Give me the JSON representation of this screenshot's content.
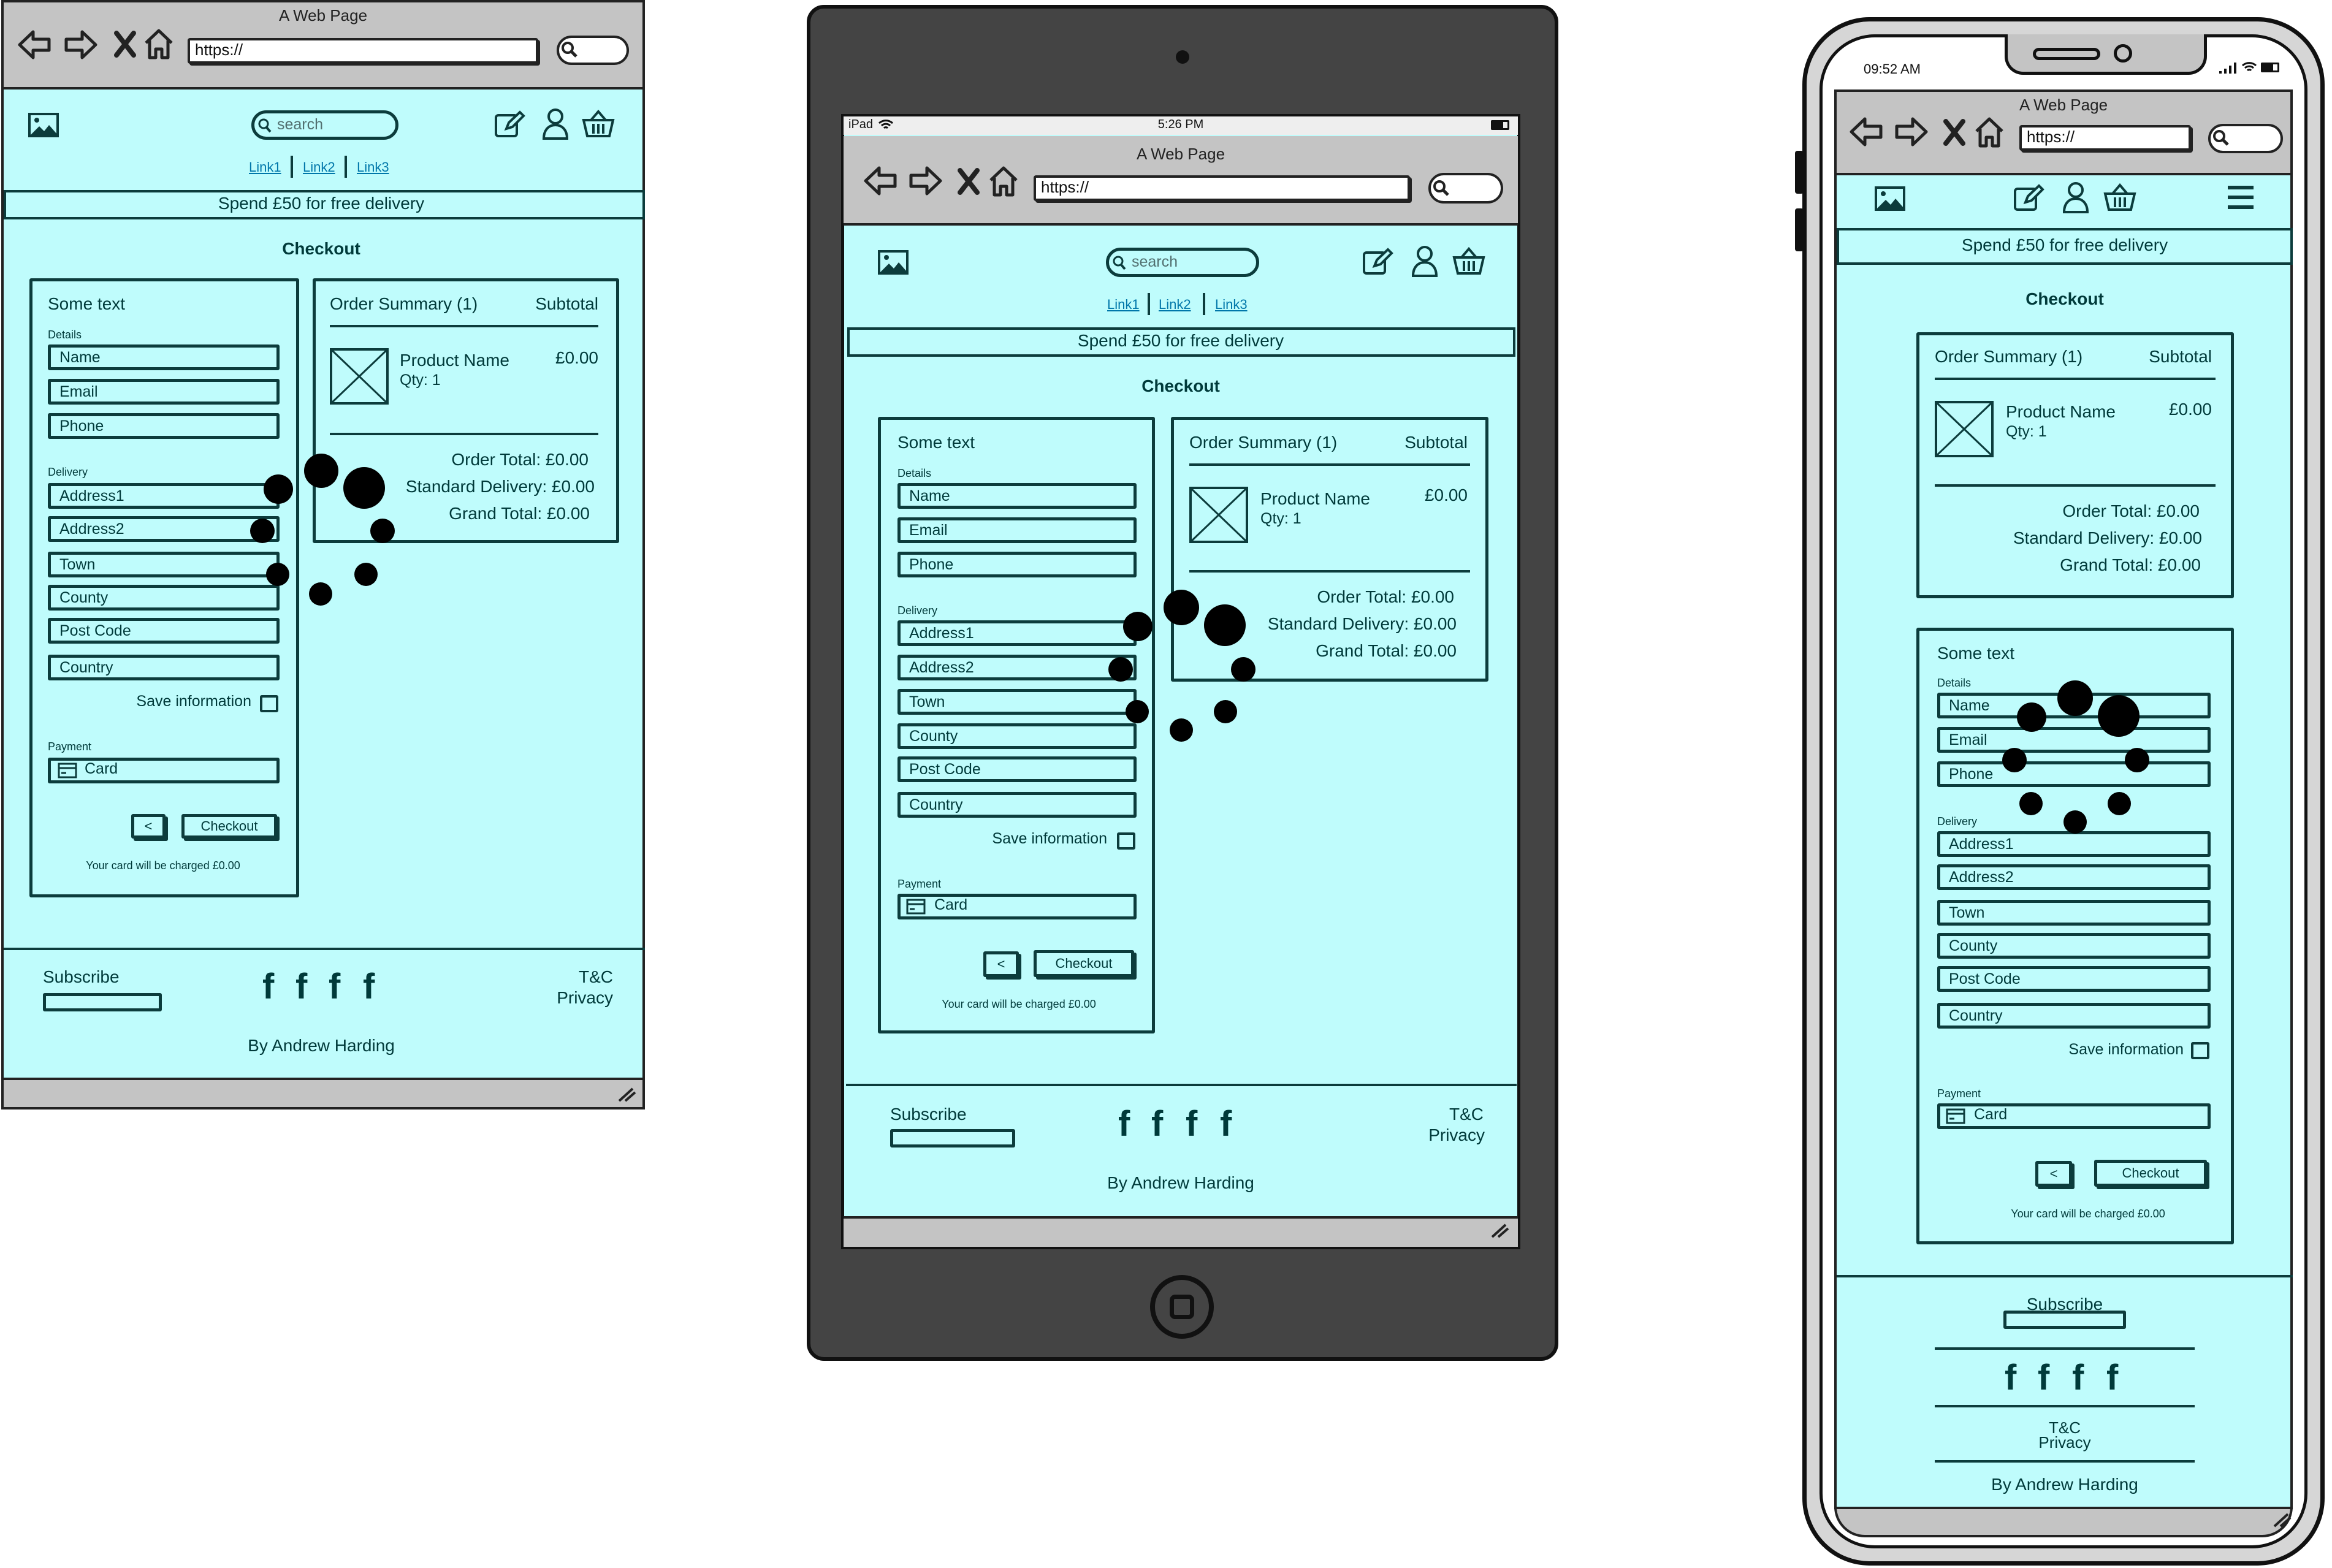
{
  "window_title": "A Web Page",
  "url": "https://",
  "search_placeholder": "search",
  "nav_links": [
    "Link1",
    "Link2",
    "Link3"
  ],
  "banner": "Spend £50 for free delivery",
  "page_title": "Checkout",
  "form": {
    "heading": "Some text",
    "details_label": "Details",
    "name": "Name",
    "email": "Email",
    "phone": "Phone",
    "delivery_label": "Delivery",
    "address1": "Address1",
    "address2": "Address2",
    "town": "Town",
    "county": "County",
    "postcode": "Post Code",
    "country": "Country",
    "save_info": "Save information",
    "payment_label": "Payment",
    "card": "Card",
    "back": "<",
    "checkout": "Checkout",
    "charge_note": "Your card will be charged £0.00"
  },
  "summary": {
    "title": "Order Summary (1)",
    "subtotal_label": "Subtotal",
    "product_name": "Product Name",
    "qty": "Qty: 1",
    "price": "£0.00",
    "order_total": "Order Total: £0.00",
    "standard_delivery": "Standard Delivery: £0.00",
    "grand_total": "Grand Total: £0.00"
  },
  "footer": {
    "subscribe": "Subscribe",
    "social": "f",
    "tc": "T&C",
    "privacy": "Privacy",
    "credit": "By Andrew Harding"
  },
  "tablet_status": {
    "device": "iPad",
    "time": "5:26 PM"
  },
  "phone_status": {
    "time": "09:52 AM"
  },
  "colors": {
    "page_bg": "#bffcfc",
    "ink": "#0c3c3c",
    "chrome": "#c0c0c0",
    "tablet_body": "#444444",
    "link": "#0077aa"
  }
}
